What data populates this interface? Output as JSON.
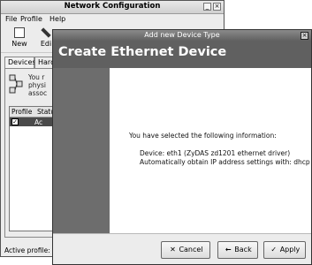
{
  "back_window": {
    "title": "Network Configuration",
    "menu": [
      {
        "label": "File",
        "underline": "F"
      },
      {
        "label": "Profile",
        "underline": "P"
      },
      {
        "label": "Help",
        "underline": "H"
      }
    ],
    "toolbar": {
      "new_label": "New",
      "edit_label": "Edi"
    },
    "tabs": {
      "devices": "Devices",
      "hardware": "Hard"
    },
    "info_lines": [
      "You r",
      "physi",
      "assoc"
    ],
    "list_header": {
      "profile": "Profile",
      "status": "Status"
    },
    "list_row_text": "Ac",
    "status_bar": "Active profile: Co"
  },
  "dialog": {
    "title": "Add new Device Type",
    "banner": "Create Ethernet Device",
    "intro": "You have selected the following information:",
    "device_line": "Device: eth1 (ZyDAS zd1201 ethernet driver)",
    "dhcp_line": "Automatically obtain IP address settings with: dhcp",
    "buttons": {
      "cancel": "Cancel",
      "back": "Back",
      "apply": "Apply"
    }
  },
  "icons": {
    "close": "close-icon",
    "new": "new-document-icon",
    "edit": "edit-pencil-icon",
    "device": "network-device-icon",
    "cancel": "cancel-x-icon",
    "back": "back-arrow-icon",
    "apply": "checkmark-icon"
  },
  "colors": {
    "banner": "#606060",
    "sidebar": "#6d6d6d",
    "dialog_titlebar": "#5e5e5e",
    "selected_row": "#4a4a4a"
  }
}
